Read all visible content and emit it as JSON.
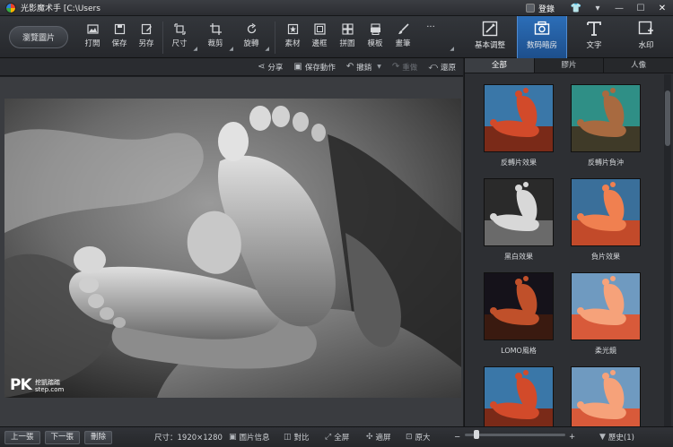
{
  "titlebar": {
    "title": "光影魔术手 [C:\\Users",
    "login_label": "登錄"
  },
  "toolbar": {
    "browse_label": "瀏覽圖片",
    "tools": [
      {
        "label": "打開",
        "icon": "open-image-icon"
      },
      {
        "label": "保存",
        "icon": "save-icon"
      },
      {
        "label": "另存",
        "icon": "save-as-icon"
      },
      {
        "label": "尺寸",
        "icon": "resize-icon"
      },
      {
        "label": "裁剪",
        "icon": "crop-icon"
      },
      {
        "label": "旋轉",
        "icon": "rotate-icon"
      },
      {
        "label": "素材",
        "icon": "material-icon"
      },
      {
        "label": "邊框",
        "icon": "border-icon"
      },
      {
        "label": "拼圖",
        "icon": "collage-icon"
      },
      {
        "label": "模板",
        "icon": "template-icon"
      },
      {
        "label": "畫筆",
        "icon": "brush-icon"
      }
    ],
    "more_label": "···",
    "modes": [
      {
        "label": "基本调整",
        "icon": "basic-adjust-icon"
      },
      {
        "label": "数码暗房",
        "icon": "digital-darkroom-icon"
      },
      {
        "label": "文字",
        "icon": "text-icon"
      },
      {
        "label": "水印",
        "icon": "watermark-icon"
      }
    ]
  },
  "actionbar": {
    "share": "分享",
    "save_action": "保存動作",
    "undo": "撤銷",
    "redo": "重做",
    "restore": "還原"
  },
  "panel": {
    "tabs": [
      "全部",
      "膠片",
      "人像"
    ],
    "filters": [
      {
        "name": "反轉片效果",
        "tone": "vivid"
      },
      {
        "name": "反轉片負沖",
        "tone": "cross"
      },
      {
        "name": "黑白效果",
        "tone": "bw"
      },
      {
        "name": "負片效果",
        "tone": "negative"
      },
      {
        "name": "LOMO風格",
        "tone": "lomo"
      },
      {
        "name": "柔光鏡",
        "tone": "soft"
      },
      {
        "name": "",
        "tone": "vivid"
      },
      {
        "name": "",
        "tone": "soft"
      }
    ]
  },
  "canvas": {
    "watermark_main": "PK",
    "watermark_sub": "挖凱踏踏",
    "watermark_url": "step.com"
  },
  "bottombar": {
    "prev": "上一張",
    "next": "下一張",
    "delete": "刪除",
    "size_label": "尺寸：1920×1280",
    "image_info": "圖片信息",
    "compare": "對比",
    "fullscreen": "全屏",
    "fit": "適屏",
    "zoom_in_label": "原大",
    "zoom_minus": "−",
    "zoom_plus": "+",
    "history": "歷史(1)"
  },
  "colors": {
    "accent": "#2c6eb8",
    "background": "#1f2124",
    "panel": "#2d2f33"
  }
}
